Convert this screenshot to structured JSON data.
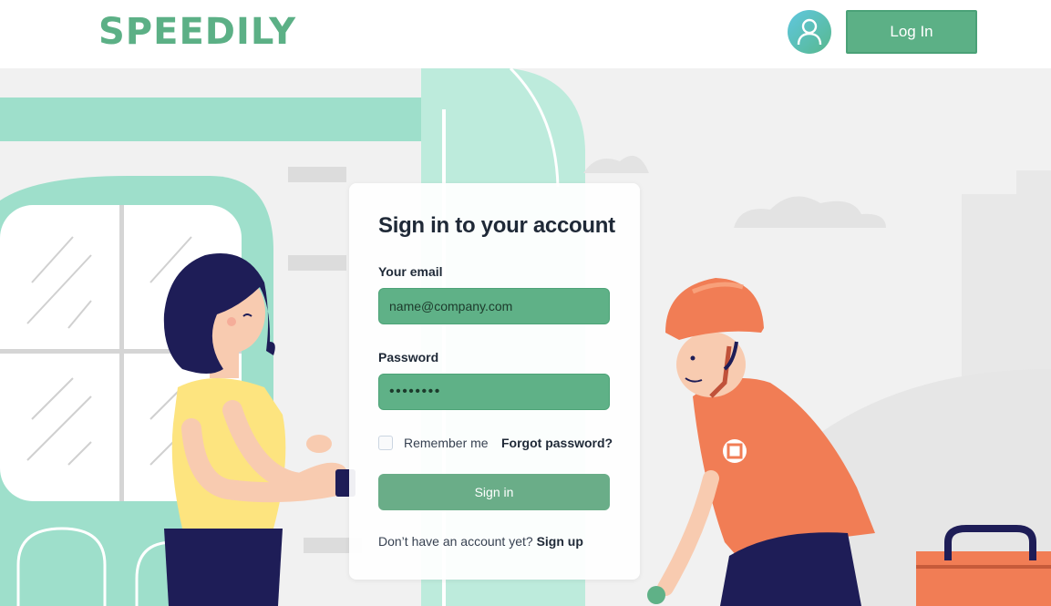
{
  "header": {
    "logo_text": "SPEEDILY",
    "login_label": "Log In",
    "avatar_icon": "user-icon"
  },
  "signin": {
    "title": "Sign in to your account",
    "email_label": "Your email",
    "email_placeholder": "name@company.com",
    "password_label": "Password",
    "password_value": "••••••••",
    "remember_label": "Remember me",
    "forgot_label": "Forgot password?",
    "submit_label": "Sign in",
    "signup_prompt": "Don’t have an account yet?",
    "signup_link": "Sign up"
  },
  "colors": {
    "brand_green": "#5cb086",
    "field_green": "#5fb187",
    "mint": "#9edfcb"
  }
}
